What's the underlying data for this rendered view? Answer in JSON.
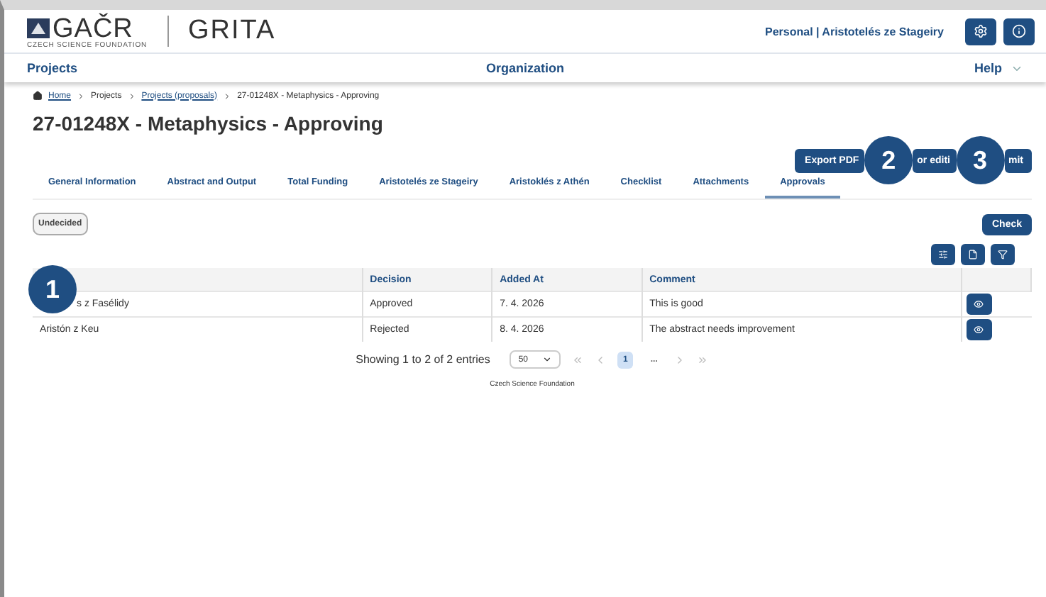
{
  "header": {
    "logo_text": "GAČR",
    "logo_subtitle": "CZECH SCIENCE FOUNDATION",
    "app_name": "GRITA",
    "user": "Personal | Aristotelés ze Stageiry"
  },
  "nav": {
    "left": "Projects",
    "center": "Organization",
    "right": "Help"
  },
  "breadcrumb": [
    {
      "label": "Home",
      "link": true
    },
    {
      "label": "Projects",
      "link": false
    },
    {
      "label": "Projects (proposals)",
      "link": true
    },
    {
      "label": "27-01248X - Metaphysics - Approving",
      "link": false
    }
  ],
  "title": "27-01248X - Metaphysics - Approving",
  "actions": [
    {
      "label": "Export PDF"
    },
    {
      "label": "or editi",
      "callout": "2"
    },
    {
      "label": "mit",
      "callout": "3"
    }
  ],
  "tabs": [
    {
      "label": "General Information",
      "selected": false
    },
    {
      "label": "Abstract and Output",
      "selected": false
    },
    {
      "label": "Total Funding",
      "selected": false
    },
    {
      "label": "Aristotelés ze Stageiry",
      "selected": false
    },
    {
      "label": "Aristoklés z Athén",
      "selected": false
    },
    {
      "label": "Checklist",
      "selected": false
    },
    {
      "label": "Attachments",
      "selected": false
    },
    {
      "label": "Approvals",
      "selected": true
    }
  ],
  "status_chip": "Undecided",
  "check_button": "Check",
  "table": {
    "callout": "1",
    "columns": [
      "Decision",
      "Added At",
      "Comment"
    ],
    "rows": [
      {
        "name": "s z Fasélidy",
        "decision": "Approved",
        "added_at": "7. 4. 2026",
        "comment": "This is good"
      },
      {
        "name": "Aristón z Keu",
        "decision": "Rejected",
        "added_at": "8. 4. 2026",
        "comment": "The abstract needs improvement"
      }
    ]
  },
  "pagination": {
    "summary": "Showing 1 to 2 of 2 entries",
    "page_size": "50",
    "pages": [
      {
        "label": "1",
        "selected": true
      },
      {
        "label": "...",
        "selected": false
      }
    ]
  },
  "footer": "Czech Science Foundation"
}
